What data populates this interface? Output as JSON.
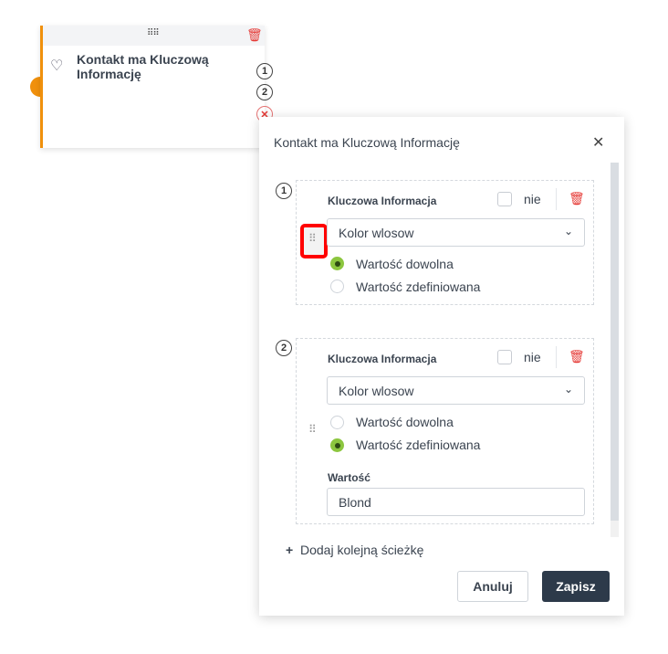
{
  "node": {
    "title": "Kontakt ma Kluczową Informację",
    "outputs": [
      "1",
      "2"
    ]
  },
  "modal": {
    "title": "Kontakt ma Kluczową Informację",
    "paths": [
      {
        "number": "1",
        "label": "Kluczowa Informacja",
        "negate_label": "nie",
        "negated": false,
        "select_value": "Kolor wlosow",
        "options": [
          "Wartość dowolna",
          "Wartość zdefiniowana"
        ],
        "selected_option": 0
      },
      {
        "number": "2",
        "label": "Kluczowa Informacja",
        "negate_label": "nie",
        "negated": false,
        "select_value": "Kolor wlosow",
        "options": [
          "Wartość dowolna",
          "Wartość zdefiniowana"
        ],
        "selected_option": 1,
        "value_label": "Wartość",
        "value": "Blond"
      }
    ],
    "add_path_label": "Dodaj kolejną ścieżkę",
    "cancel_label": "Anuluj",
    "save_label": "Zapisz"
  },
  "colors": {
    "accent": "#f0900c",
    "danger": "#e53935",
    "radio_on": "#8cc63f",
    "primary_button": "#2d3a4a",
    "highlight": "#ff0000"
  }
}
